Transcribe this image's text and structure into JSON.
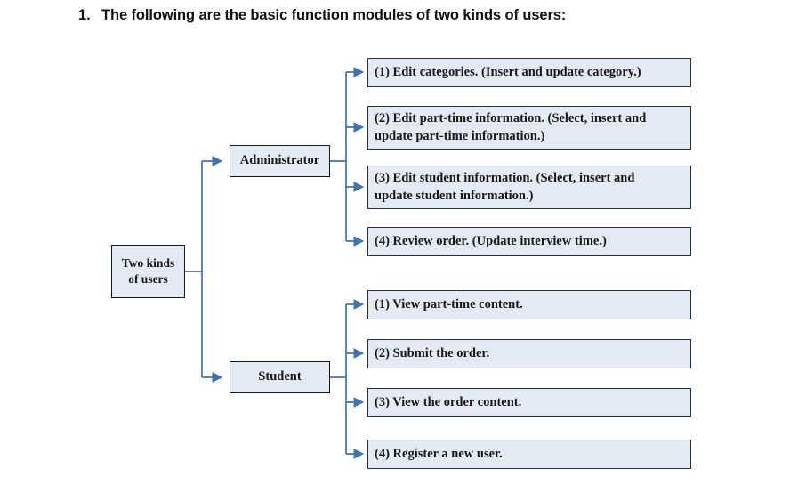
{
  "heading": {
    "number": "1.",
    "text": "The following are the basic function modules of two kinds of users:"
  },
  "diagram": {
    "root": {
      "label_line1": "Two kinds",
      "label_line2": "of users"
    },
    "branches": [
      {
        "role_label": "Administrator",
        "items": [
          {
            "text_line1": "(1) Edit categories. (Insert and update category.)",
            "text_line2": ""
          },
          {
            "text_line1": "(2) Edit part-time information. (Select, insert and",
            "text_line2": "update part-time information.)"
          },
          {
            "text_line1": "(3) Edit student information. (Select, insert and",
            "text_line2": "update student information.)"
          },
          {
            "text_line1": "(4) Review order. (Update interview time.)",
            "text_line2": ""
          }
        ]
      },
      {
        "role_label": "Student",
        "items": [
          {
            "text_line1": "(1) View part-time content.",
            "text_line2": ""
          },
          {
            "text_line1": "(2) Submit the order.",
            "text_line2": ""
          },
          {
            "text_line1": "(3) View the order content.",
            "text_line2": ""
          },
          {
            "text_line1": "(4) Register a new user.",
            "text_line2": ""
          }
        ]
      }
    ]
  },
  "colors": {
    "box_fill": "#e4eaf4",
    "box_border_dark": "#1a1a1a",
    "box_border_leaf": "#27303e",
    "connector": "#4373ab",
    "text": "#17181c",
    "background": "#ffffff"
  }
}
